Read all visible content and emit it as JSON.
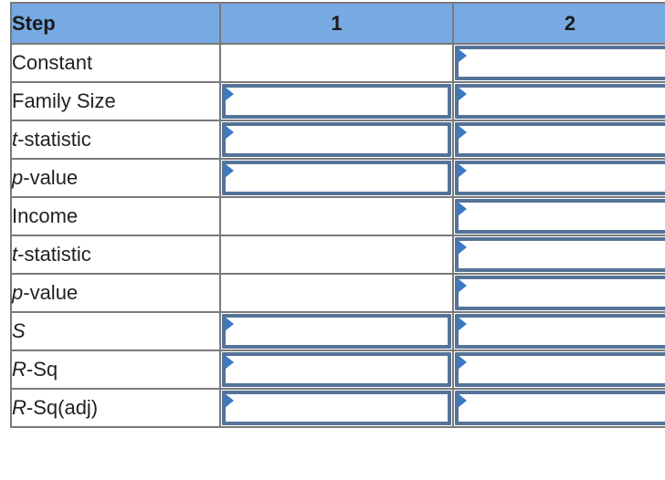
{
  "table": {
    "header": {
      "step_label": "Step",
      "col1": "1",
      "col2": "2"
    },
    "rows": [
      {
        "prefix": "",
        "italic": "",
        "suffix": "Constant",
        "col1_input": false,
        "col2_input": true,
        "col1_value": "",
        "col2_value": ""
      },
      {
        "prefix": "",
        "italic": "",
        "suffix": "Family Size",
        "col1_input": true,
        "col2_input": true,
        "col1_value": "",
        "col2_value": ""
      },
      {
        "prefix": "",
        "italic": "t",
        "suffix": "-statistic",
        "col1_input": true,
        "col2_input": true,
        "col1_value": "",
        "col2_value": ""
      },
      {
        "prefix": "",
        "italic": "p",
        "suffix": "-value",
        "col1_input": true,
        "col2_input": true,
        "col1_value": "",
        "col2_value": ""
      },
      {
        "prefix": "",
        "italic": "",
        "suffix": "Income",
        "col1_input": false,
        "col2_input": true,
        "col1_value": "",
        "col2_value": ""
      },
      {
        "prefix": "",
        "italic": "t",
        "suffix": "-statistic",
        "col1_input": false,
        "col2_input": true,
        "col1_value": "",
        "col2_value": ""
      },
      {
        "prefix": "",
        "italic": "p",
        "suffix": "-value",
        "col1_input": false,
        "col2_input": true,
        "col1_value": "",
        "col2_value": ""
      },
      {
        "prefix": "",
        "italic": "S",
        "suffix": "",
        "col1_input": true,
        "col2_input": true,
        "col1_value": "",
        "col2_value": ""
      },
      {
        "prefix": "",
        "italic": "R",
        "suffix": "-Sq",
        "col1_input": true,
        "col2_input": true,
        "col1_value": "",
        "col2_value": ""
      },
      {
        "prefix": "",
        "italic": "R",
        "suffix": "-Sq(adj)",
        "col1_input": true,
        "col2_input": true,
        "col1_value": "",
        "col2_value": ""
      }
    ]
  },
  "colors": {
    "header_bg": "#77a9e2",
    "input_border": "#557399",
    "dropdown_flag": "#3c79c4",
    "grid": "#7a7a7a"
  }
}
